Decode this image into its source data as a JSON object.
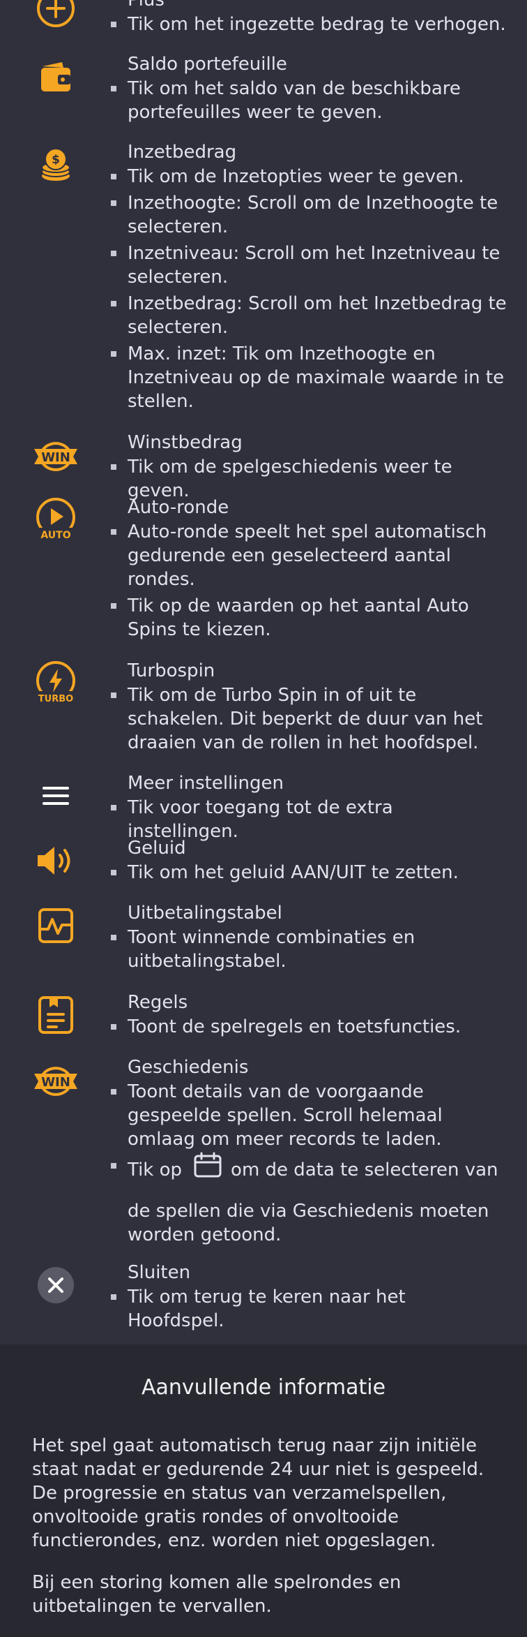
{
  "sections": [
    {
      "icon": "plus-circle-icon",
      "title": "Plus",
      "bullets": [
        "Tik om het ingezette bedrag te verhogen."
      ]
    },
    {
      "icon": "wallet-icon",
      "title": "Saldo portefeuille",
      "bullets": [
        "Tik om het saldo van de beschikbare portefeuilles weer te geven."
      ]
    },
    {
      "icon": "coin-stack-icon",
      "title": "Inzetbedrag",
      "bullets": [
        "Tik om de Inzetopties weer te geven.",
        "Inzethoogte: Scroll om de Inzethoogte te selecteren.",
        "Inzetniveau: Scroll om het Inzetniveau te selecteren.",
        "Inzetbedrag: Scroll om het Inzetbedrag te selecteren.",
        "Max. inzet: Tik om Inzethoogte en Inzetniveau op de maximale waarde in te stellen."
      ]
    },
    {
      "icon": "win-badge-icon",
      "icon_text": "WIN",
      "title": "Winstbedrag",
      "bullets": [
        "Tik om de spelgeschiedenis weer te geven."
      ]
    },
    {
      "icon": "auto-play-icon",
      "icon_text": "AUTO",
      "title": "Auto-ronde",
      "bullets": [
        "Auto-ronde speelt het spel automatisch gedurende een geselecteerd aantal rondes.",
        "Tik op de waarden op het aantal Auto Spins te kiezen."
      ]
    },
    {
      "icon": "turbo-icon",
      "icon_text": "TURBO",
      "title": "Turbospin",
      "bullets": [
        "Tik om de Turbo Spin in of uit te schakelen. Dit beperkt de duur van het draaien van de rollen in het hoofdspel."
      ]
    },
    {
      "icon": "menu-icon",
      "title": "Meer instellingen",
      "bullets": [
        "Tik voor toegang tot de extra instellingen."
      ]
    },
    {
      "icon": "sound-icon",
      "title": "Geluid",
      "bullets": [
        "Tik om het geluid AAN/UIT te zetten."
      ]
    },
    {
      "icon": "paytable-icon",
      "title": "Uitbetalingstabel",
      "bullets": [
        "Toont winnende combinaties en uitbetalingstabel."
      ]
    },
    {
      "icon": "rules-icon",
      "title": "Regels",
      "bullets": [
        "Toont de spelregels en toetsfuncties."
      ]
    },
    {
      "icon": "win-badge-icon",
      "icon_text": "WIN",
      "title": "Geschiedenis",
      "bullets": [
        "Toont details van de voorgaande gespeelde spellen. Scroll helemaal omlaag om meer records te laden."
      ],
      "calendar_bullet": {
        "before": "Tik op",
        "after": "om de data te selecteren van",
        "continuation": "de spellen die via Geschiedenis moeten worden getoond."
      }
    },
    {
      "icon": "close-icon",
      "title": "Sluiten",
      "bullets": [
        "Tik om terug te keren naar het Hoofdspel."
      ]
    }
  ],
  "extra_info": {
    "heading": "Aanvullende informatie",
    "paragraphs": [
      "Het spel gaat automatisch terug naar zijn initiële staat nadat er gedurende 24 uur niet is gespeeld. De progressie en status van verzamelspellen, onvoltooide gratis rondes of onvoltooide functierondes, enz. worden niet opgeslagen.",
      "Bij een storing komen alle spelrondes en uitbetalingen te vervallen."
    ]
  },
  "colors": {
    "accent": "#f5a623",
    "background": "#30303c",
    "footer_background": "#282831",
    "text": "#e2e2ea"
  }
}
